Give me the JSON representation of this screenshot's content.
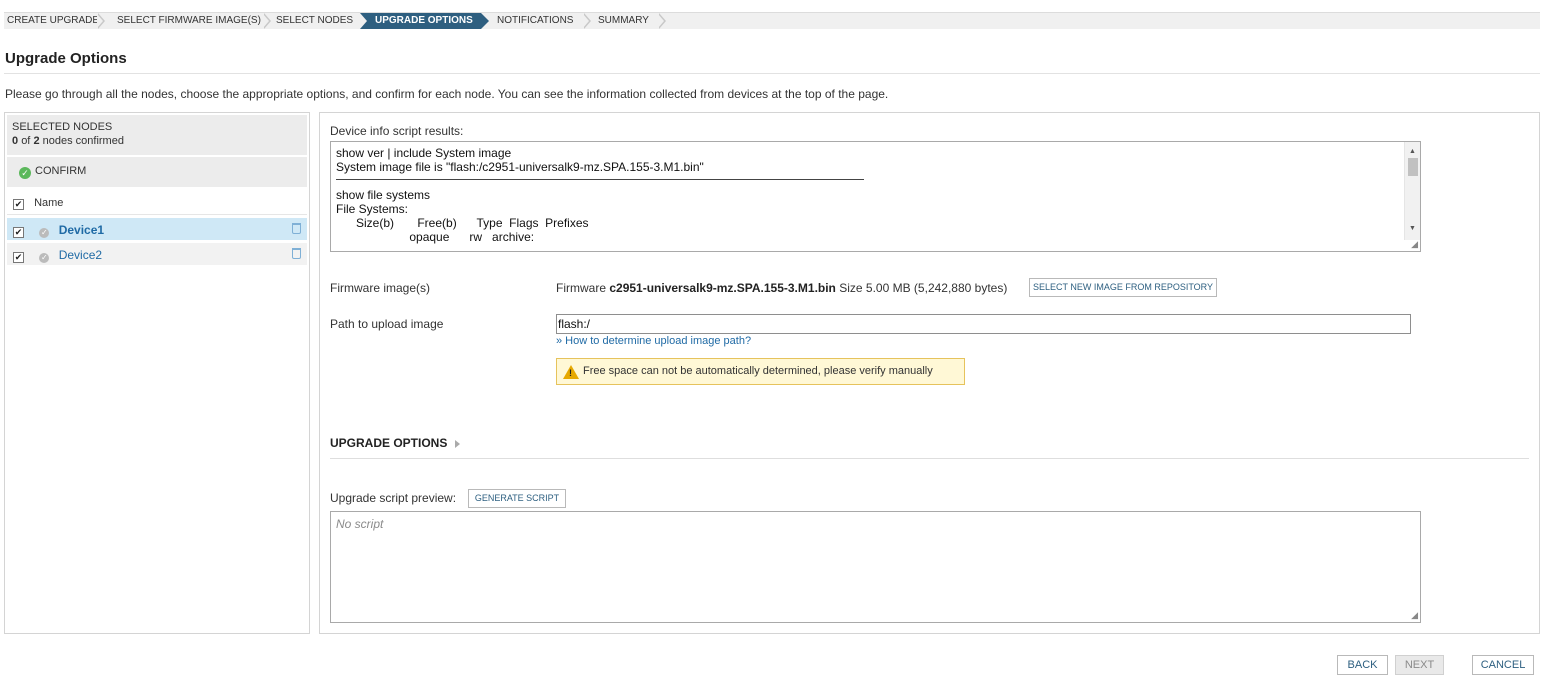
{
  "wizard": {
    "steps": [
      {
        "label": "CREATE UPGRADE"
      },
      {
        "label": "SELECT FIRMWARE IMAGE(S)"
      },
      {
        "label": "SELECT NODES"
      },
      {
        "label": "UPGRADE OPTIONS",
        "active": true
      },
      {
        "label": "NOTIFICATIONS"
      },
      {
        "label": "SUMMARY"
      }
    ]
  },
  "page": {
    "title": "Upgrade Options",
    "description": "Please go through all the nodes, choose the appropriate options, and confirm for each node. You can see the information collected from devices at the top of the page."
  },
  "left_panel": {
    "header": "SELECTED NODES",
    "confirmed_count": "0",
    "total_count": "2",
    "confirmed_text_of": "of",
    "confirmed_text_suffix": "nodes confirmed",
    "confirm_button": "CONFIRM",
    "name_column": "Name",
    "nodes": [
      {
        "name": "Device1",
        "selected": true
      },
      {
        "name": "Device2",
        "selected": false
      }
    ]
  },
  "right_panel": {
    "device_info_label": "Device info script results:",
    "device_info_lines": [
      "show ver | include System image",
      "System image file is \"flash:/c2951-universalk9-mz.SPA.155-3.M1.bin\"",
      "",
      "show file systems",
      "File Systems:",
      "      Size(b)       Free(b)      Type  Flags  Prefixes",
      "                      opaque      rw   archive:"
    ],
    "firmware_label": "Firmware image(s)",
    "firmware_prefix": "Firmware",
    "firmware_name": "c2951-universalk9-mz.SPA.155-3.M1.bin",
    "firmware_size": "Size 5.00 MB (5,242,880 bytes)",
    "select_image_button": "SELECT NEW IMAGE FROM REPOSITORY",
    "path_label": "Path to upload image",
    "path_value": "flash:/",
    "help_link": "» How to determine upload image path?",
    "warning_text": "Free space can not be automatically determined, please verify manually",
    "upgrade_options_heading": "UPGRADE OPTIONS",
    "script_preview_label": "Upgrade script preview:",
    "generate_script_button": "GENERATE SCRIPT",
    "script_placeholder": "No script"
  },
  "footer": {
    "back": "BACK",
    "next": "NEXT",
    "cancel": "CANCEL"
  },
  "colors": {
    "active_step": "#2e5f80",
    "link": "#1f6aa5",
    "selected_row": "#cfe8f6",
    "warning_bg": "#fff8d6",
    "confirm_icon": "#5cb85c"
  }
}
